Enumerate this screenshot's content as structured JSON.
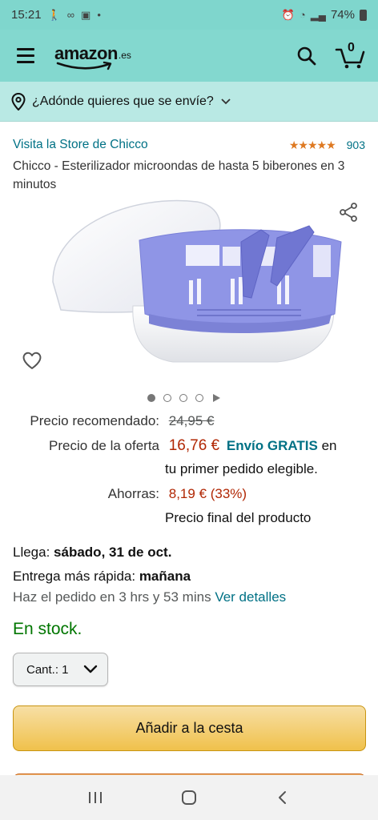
{
  "status_bar": {
    "time": "15:21",
    "battery": "74%"
  },
  "header": {
    "logo": "amazon",
    "logo_tld": ".es",
    "cart_count": "0"
  },
  "location": {
    "text": "¿Adónde quieres que se envíe?"
  },
  "product": {
    "store_link": "Visita la Store de Chicco",
    "stars": "★★★★★",
    "rating_count": "903",
    "title": "Chicco - Esterilizador microondas de hasta 5 biberones en 3 minutos"
  },
  "pricing": {
    "recommended_label": "Precio recomendado:",
    "recommended_price": "24,95 €",
    "offer_label": "Precio de la oferta",
    "offer_price": "16,76 €",
    "shipping_bold": "Envío GRATIS",
    "shipping_rest": " en",
    "shipping_line2": "tu primer pedido elegible.",
    "savings_label": "Ahorras:",
    "savings_value": "8,19 € (33%)",
    "final_note": "Precio final del producto"
  },
  "delivery": {
    "arrives_label": "Llega: ",
    "arrives_date": "sábado, 31 de oct.",
    "fastest_label": "Entrega más rápida: ",
    "fastest_value": "mañana",
    "order_within": "Haz el pedido en 3 hrs y 53 mins ",
    "details_link": "Ver detalles"
  },
  "stock": {
    "status": "En stock."
  },
  "quantity": {
    "label": "Cant.: 1"
  },
  "buttons": {
    "add_to_cart": "Añadir a la cesta"
  },
  "carousel": {
    "total_dots": 4,
    "active_index": 0
  },
  "colors": {
    "header_bg": "#83d8cf",
    "link": "#007185",
    "price": "#b12704",
    "in_stock": "#007600",
    "star": "#de7921"
  }
}
